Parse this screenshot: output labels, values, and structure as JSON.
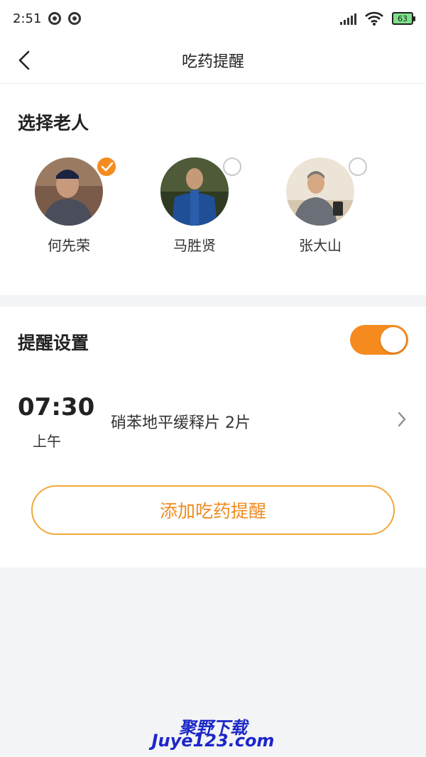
{
  "status_bar": {
    "time": "2:51",
    "battery": "63"
  },
  "nav": {
    "title": "吃药提醒"
  },
  "select_elder": {
    "title": "选择老人",
    "people": [
      {
        "name": "何先荣",
        "selected": true
      },
      {
        "name": "马胜贤",
        "selected": false
      },
      {
        "name": "张大山",
        "selected": false
      }
    ]
  },
  "reminder_settings": {
    "title": "提醒设置",
    "enabled": true,
    "reminders": [
      {
        "time": "07:30",
        "period": "上午",
        "medicine": "硝苯地平缓释片 2片"
      }
    ],
    "add_label": "添加吃药提醒"
  },
  "watermark": {
    "line1": "聚野下载",
    "line2": "Juye123.com"
  },
  "colors": {
    "accent": "#f58b1f",
    "background": "#f3f4f6"
  }
}
